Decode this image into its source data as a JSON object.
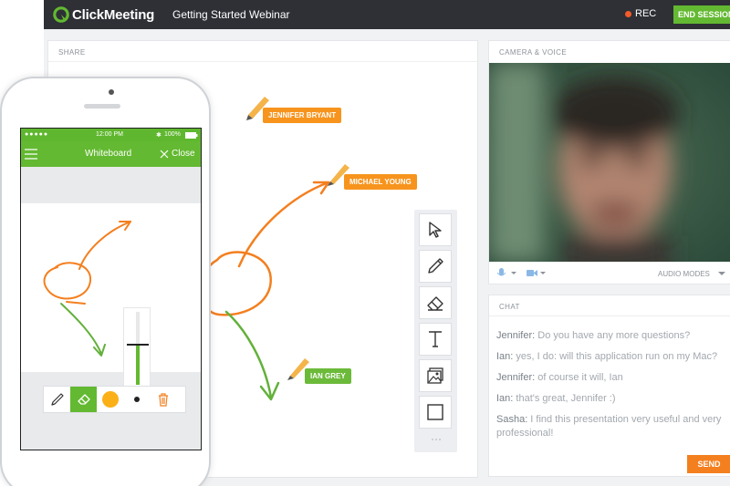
{
  "app": {
    "logo_text": "ClickMeeting",
    "webinar_title": "Getting Started Webinar",
    "rec_label": "REC",
    "end_session_label": "END SESSION"
  },
  "share": {
    "header": "SHARE",
    "users": [
      {
        "name": "JENNIFER BRYANT",
        "color": "#f7941d"
      },
      {
        "name": "MICHAEL YOUNG",
        "color": "#f7941d"
      },
      {
        "name": "IAN GREY",
        "color": "#6cba3a"
      }
    ],
    "tools": [
      "pointer-icon",
      "pencil-icon",
      "eraser-icon",
      "text-icon",
      "image-icon",
      "rectangle-icon"
    ]
  },
  "camera": {
    "header": "CAMERA & VOICE",
    "audio_modes_label": "AUDIO MODES"
  },
  "chat": {
    "header": "CHAT",
    "messages": [
      {
        "author": "Jennifer:",
        "text": " Do you have any more questions?"
      },
      {
        "author": "Ian:",
        "text": " yes, I do: will this application run on my Mac?"
      },
      {
        "author": "Jennifer:",
        "text": " of course it will, Ian"
      },
      {
        "author": "Ian:",
        "text": " that's great, Jennifer :)"
      },
      {
        "author": "Sasha:",
        "text": " I find this presentation very useful and very professional!"
      }
    ],
    "send_label": "SEND"
  },
  "phone": {
    "time": "12:00 PM",
    "battery": "100%",
    "nav_title": "Whiteboard",
    "close_label": "Close"
  },
  "colors": {
    "brand_green": "#63b931",
    "orange": "#f7941d",
    "topbar": "#2e3036"
  }
}
